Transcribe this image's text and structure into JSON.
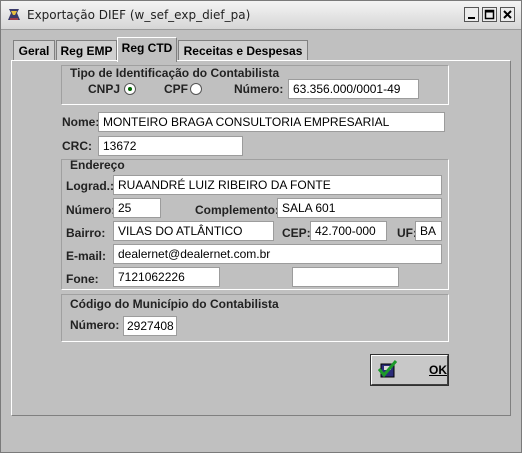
{
  "window": {
    "title": "Exportação DIEF (w_sef_exp_dief_pa)"
  },
  "tabs": [
    {
      "label": "Geral"
    },
    {
      "label": "Reg EMP"
    },
    {
      "label": "Reg CTD"
    },
    {
      "label": "Receitas e Despesas"
    }
  ],
  "active_tab": "Reg CTD",
  "tipo_identificacao": {
    "title": "Tipo de Identificação do Contabilista",
    "cnpj_label": "CNPJ",
    "cpf_label": "CPF",
    "selected": "CNPJ",
    "numero_label": "Número:",
    "numero_value": "63.356.000/0001-49"
  },
  "nome": {
    "label": "Nome:",
    "value": "MONTEIRO BRAGA CONSULTORIA EMPRESARIAL"
  },
  "crc": {
    "label": "CRC:",
    "value": "13672"
  },
  "endereco": {
    "title": "Endereço",
    "lograd_label": "Lograd.:",
    "lograd_value": "RUAANDRÉ LUIZ RIBEIRO DA FONTE",
    "numero_label": "Número:",
    "numero_value": "25",
    "complemento_label": "Complemento:",
    "complemento_value": "SALA 601",
    "bairro_label": "Bairro:",
    "bairro_value": "VILAS DO ATLÂNTICO",
    "cep_label": "CEP:",
    "cep_value": "42.700-000",
    "uf_label": "UF:",
    "uf_value": "BA",
    "email_label": "E-mail:",
    "email_value": "dealernet@dealernet.com.br",
    "fone_label": "Fone:",
    "fone_value": "7121062226",
    "fone2_value": ""
  },
  "municipio": {
    "title": "Código do Município do Contabilista",
    "numero_label": "Número:",
    "numero_value": "2927408"
  },
  "ok_button": {
    "label": "OK"
  },
  "icons": {
    "app": "app-icon",
    "check": "check-icon",
    "minimize": "minimize-icon",
    "maximize": "maximize-icon",
    "close": "close-icon"
  }
}
